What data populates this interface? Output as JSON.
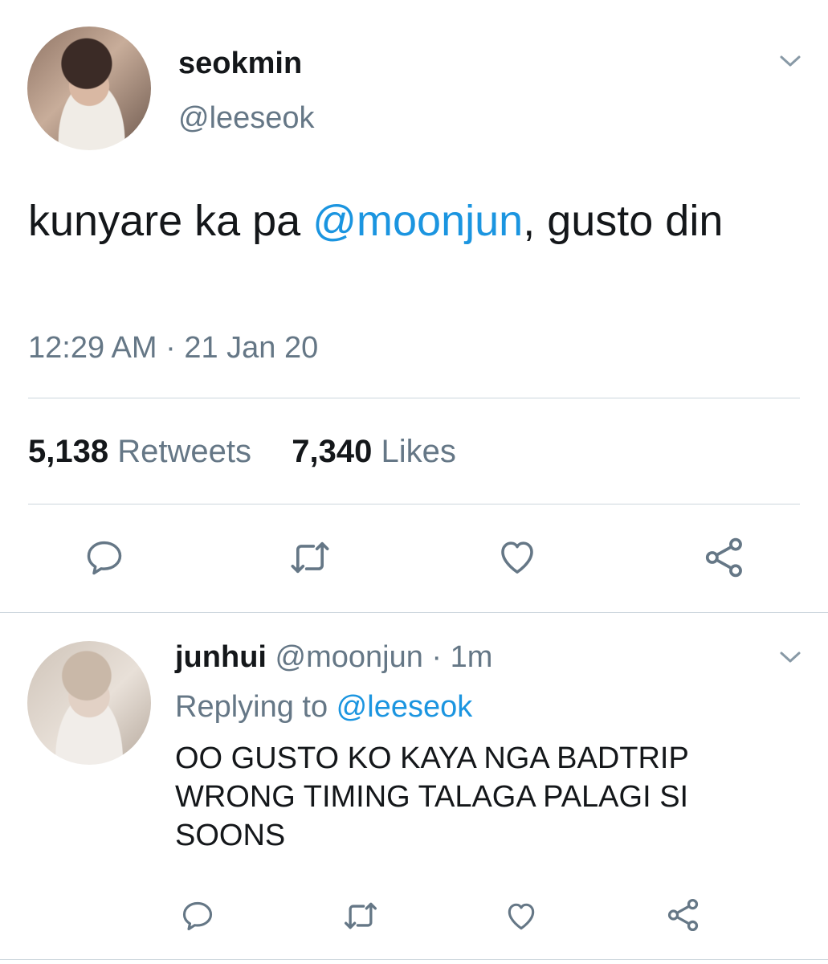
{
  "tweet": {
    "author_name": "seokmin",
    "author_handle": "@leeseok",
    "text_before": "kunyare ka pa ",
    "mention": "@moonjun",
    "text_after": ", gusto din",
    "timestamp": "12:29 AM · 21 Jan 20",
    "retweet_count": "5,138",
    "retweet_label": "Retweets",
    "like_count": "7,340",
    "like_label": "Likes",
    "icons": [
      "comment-icon",
      "retweet-icon",
      "like-icon",
      "share-icon",
      "chevron-down-icon"
    ]
  },
  "reply": {
    "author_name": "junhui",
    "author_handle": "@moonjun",
    "separator": " · ",
    "age": "1m",
    "replying_to_label": "Replying to ",
    "replying_to_handle": "@leeseok",
    "text": "OO GUSTO KO KAYA NGA BADTRIP WRONG TIMING TALAGA PALAGI SI SOONS"
  },
  "colors": {
    "text": "#14171a",
    "secondary": "#657786",
    "link": "#1b95e0",
    "divider": "#ccd6dd",
    "background": "#ffffff"
  }
}
